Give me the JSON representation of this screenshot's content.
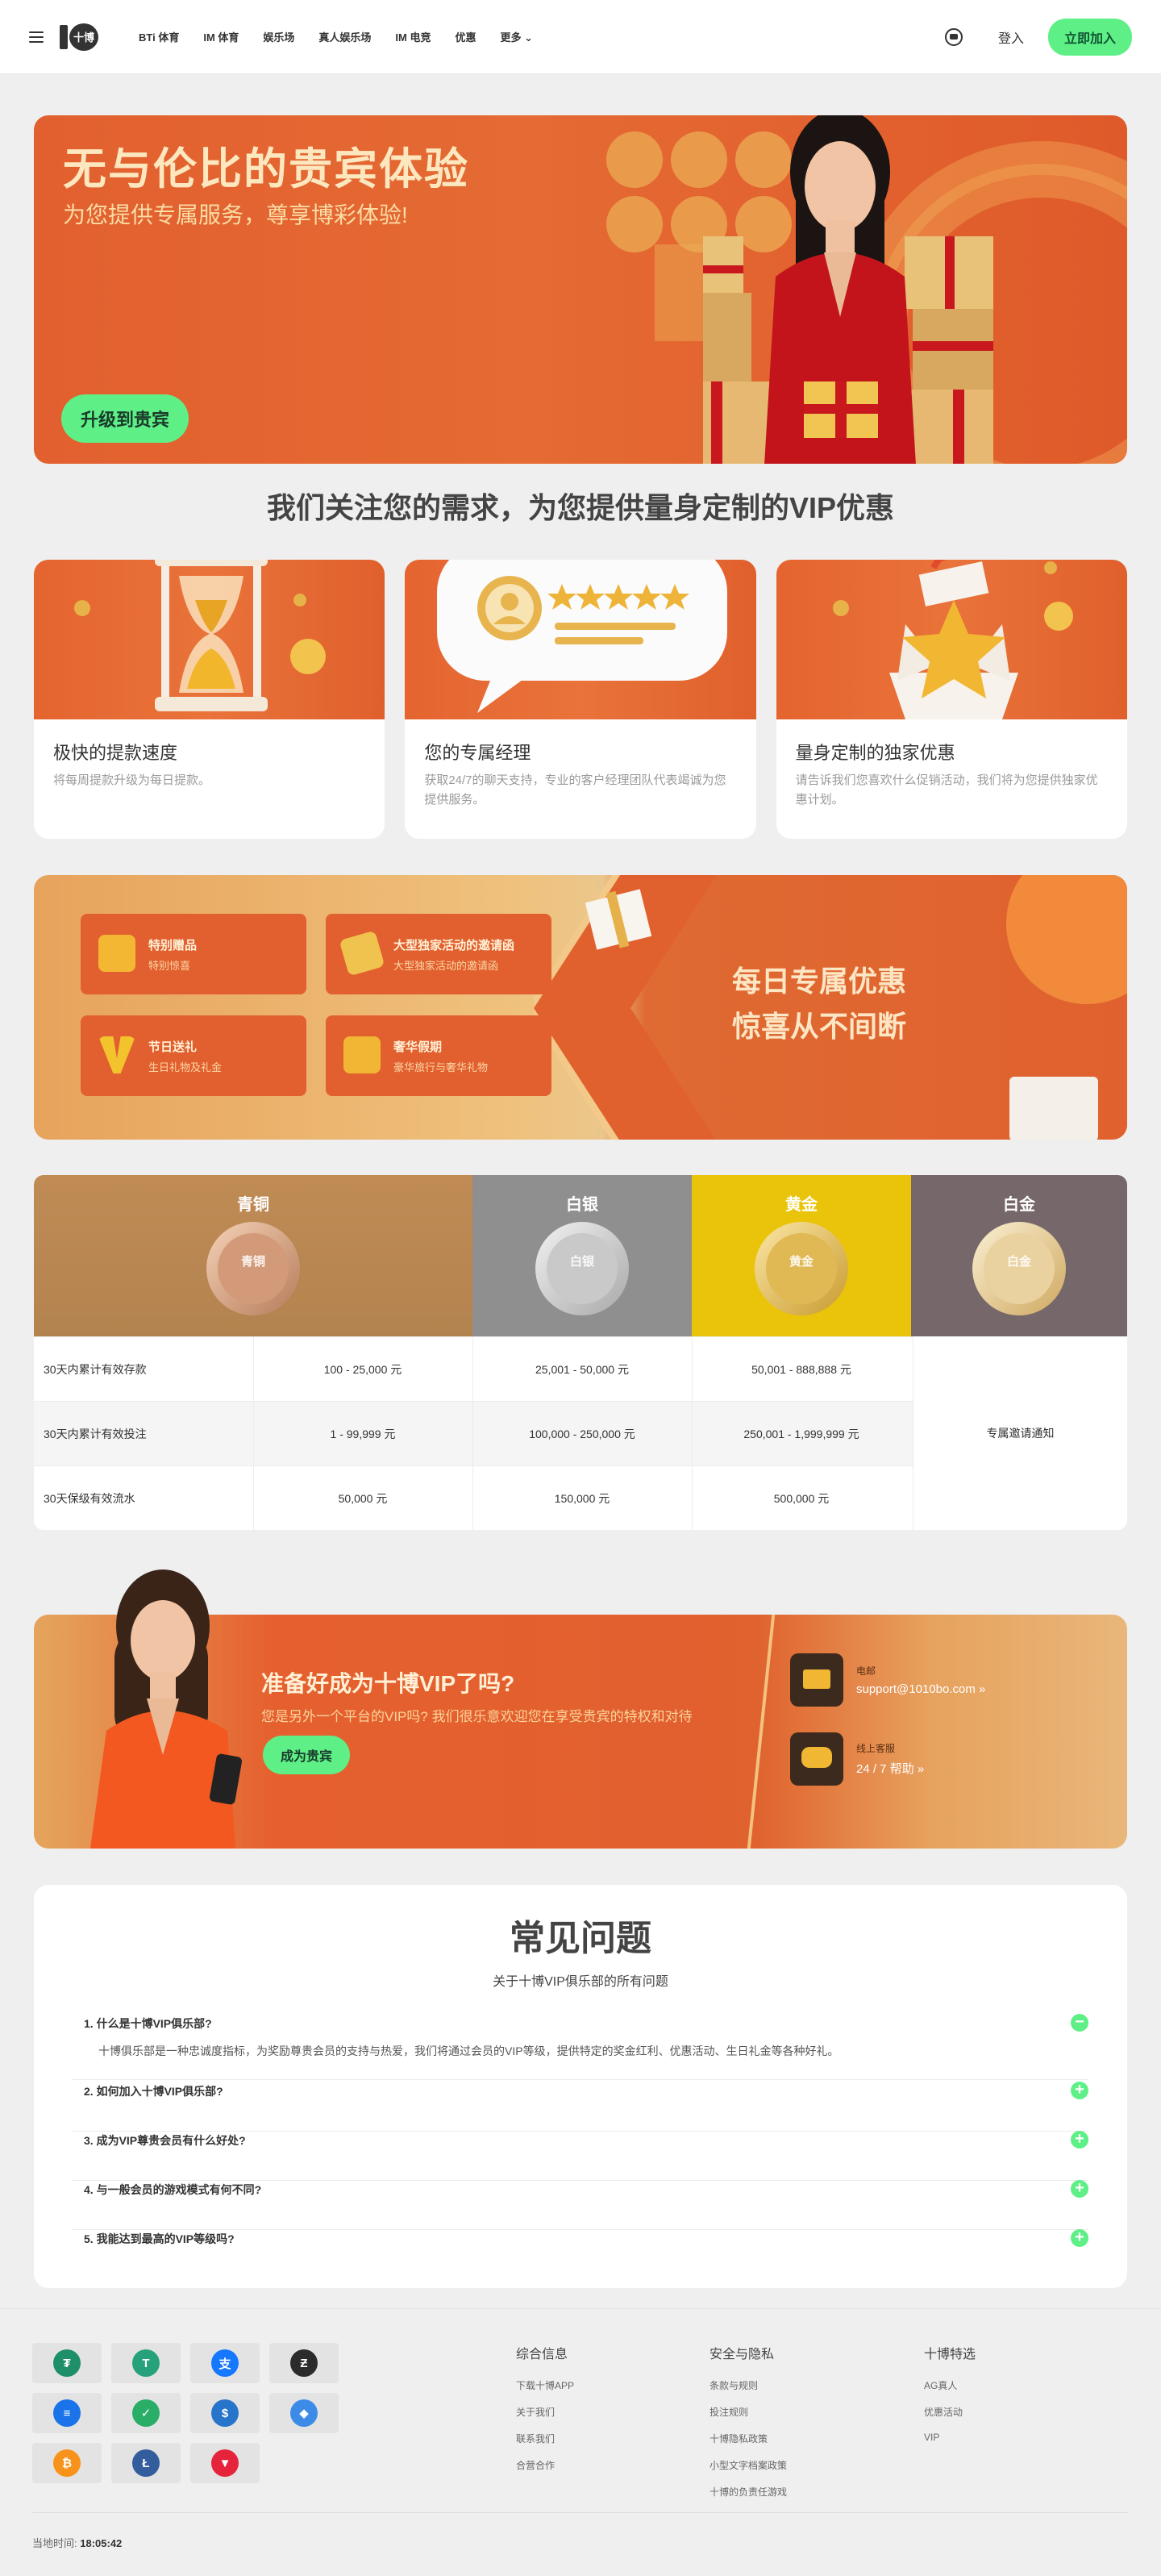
{
  "header": {
    "logo_text": "十博",
    "nav": [
      "BTi 体育",
      "IM 体育",
      "娱乐场",
      "真人娱乐场",
      "IM 电竞",
      "优惠",
      "更多"
    ],
    "login": "登入",
    "join": "立即加入"
  },
  "hero": {
    "title": "无与伦比的贵宾体验",
    "subtitle": "为您提供专属服务，尊享博彩体验!",
    "button": "升级到贵宾"
  },
  "features": {
    "heading": "我们关注您的需求，为您提供量身定制的VIP优惠",
    "cards": [
      {
        "title": "极快的提款速度",
        "desc": "将每周提款升级为每日提款。",
        "icon": "hourglass-icon"
      },
      {
        "title": "您的专属经理",
        "desc": "获取24/7的聊天支持，专业的客户经理团队代表竭诚为您提供服务。",
        "icon": "manager-rating-icon"
      },
      {
        "title": "量身定制的独家优惠",
        "desc": "请告诉我们您喜欢什么促销活动，我们将为您提供独家优惠计划。",
        "icon": "star-gift-icon"
      }
    ]
  },
  "daily": {
    "offers": [
      {
        "title": "特别赠品",
        "sub": "特别惊喜",
        "icon": "gift-box-icon"
      },
      {
        "title": "大型独家活动的邀请函",
        "sub": "大型独家活动的邀请函",
        "icon": "ticket-icon"
      },
      {
        "title": "节日送礼",
        "sub": "生日礼物及礼金",
        "icon": "v-badge-icon"
      },
      {
        "title": "奢华假期",
        "sub": "豪华旅行与奢华礼物",
        "icon": "luggage-icon"
      }
    ],
    "line1": "每日专属优惠",
    "line2": "惊喜从不间断"
  },
  "vip_table": {
    "levels": [
      {
        "name": "青铜",
        "medal": "青铜",
        "color": "#b98a56"
      },
      {
        "name": "白银",
        "medal": "白银",
        "color": "#8f8f8f"
      },
      {
        "name": "黄金",
        "medal": "黄金",
        "color": "#e9c40a"
      },
      {
        "name": "白金",
        "medal": "白金",
        "color": "#76686a"
      }
    ],
    "rows": [
      {
        "label": "30天内累计有效存款",
        "values": [
          "100 - 25,000 元",
          "25,001 - 50,000 元",
          "50,001 - 888,888 元"
        ]
      },
      {
        "label": "30天内累计有效投注",
        "values": [
          "1 - 99,999 元",
          "100,000 - 250,000 元",
          "250,001 - 1,999,999 元"
        ]
      },
      {
        "label": "30天保级有效流水",
        "values": [
          "50,000 元",
          "150,000 元",
          "500,000 元"
        ]
      }
    ],
    "platinum_note": "专属邀请通知"
  },
  "ready": {
    "title": "准备好成为十博VIP了吗?",
    "subtitle": "您是另外一个平台的VIP吗? 我们很乐意欢迎您在享受贵宾的特权和对待",
    "button": "成为贵宾",
    "email_label": "电邮",
    "email": "support@1010bo.com »",
    "chat_label": "线上客服",
    "chat": "24 / 7 帮助 »"
  },
  "faq": {
    "title": "常见问题",
    "subtitle": "关于十博VIP俱乐部的所有问题",
    "items": [
      {
        "q": "1. 什么是十博VIP俱乐部?",
        "a": "十博俱乐部是一种忠诚度指标，为奖励尊贵会员的支持与热爱，我们将通过会员的VIP等级，提供特定的奖金红利、优惠活动、生日礼金等各种好礼。",
        "toggle": "−"
      },
      {
        "q": "2. 如何加入十博VIP俱乐部?",
        "a": "",
        "toggle": "+"
      },
      {
        "q": "3. 成为VIP尊贵会员有什么好处?",
        "a": "",
        "toggle": "+"
      },
      {
        "q": "4. 与一般会员的游戏模式有何不同?",
        "a": "",
        "toggle": "+"
      },
      {
        "q": "5. 我能达到最高的VIP等级吗?",
        "a": "",
        "toggle": "+"
      }
    ]
  },
  "footer": {
    "payments": [
      {
        "icon": "tether-trc-icon",
        "color": "#1f8f6a",
        "glyph": "₮"
      },
      {
        "icon": "tether-trx-icon",
        "color": "#26a17b",
        "glyph": "T"
      },
      {
        "icon": "alipay-icon",
        "color": "#1677ff",
        "glyph": "支"
      },
      {
        "icon": "dark-coin-icon",
        "color": "#2b2b2b",
        "glyph": "Ƶ"
      },
      {
        "icon": "bank-transfer-icon",
        "color": "#1a73e8",
        "glyph": "≡"
      },
      {
        "icon": "wechat-icon",
        "color": "#2aae67",
        "glyph": "✓"
      },
      {
        "icon": "usdc-icon",
        "color": "#2775ca",
        "glyph": "$"
      },
      {
        "icon": "ethereum-icon",
        "color": "#3c8ce7",
        "glyph": "◆"
      },
      {
        "icon": "bitcoin-icon",
        "color": "#f7931a",
        "glyph": "₿"
      },
      {
        "icon": "litecoin-icon",
        "color": "#345d9d",
        "glyph": "Ł"
      },
      {
        "icon": "tron-icon",
        "color": "#e5243b",
        "glyph": "▼"
      }
    ],
    "col1": {
      "title": "综合信息",
      "links": [
        "下载十博APP",
        "关于我们",
        "联系我们",
        "合营合作"
      ]
    },
    "col2": {
      "title": "安全与隐私",
      "links": [
        "条款与规则",
        "投注规则",
        "十博隐私政策",
        "小型文字档案政策",
        "十博的负责任游戏"
      ]
    },
    "col3": {
      "title": "十博特选",
      "links": [
        "AG真人",
        "优惠活动",
        "VIP"
      ]
    },
    "time_label": "当地时间:",
    "time_value": "18:05:42"
  }
}
